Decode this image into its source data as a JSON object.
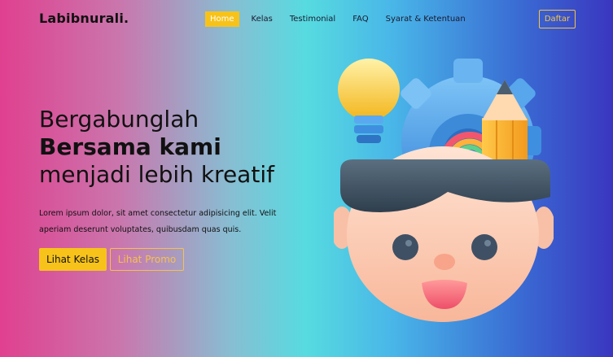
{
  "brand": {
    "logo_text": "Labibnurali."
  },
  "nav": {
    "items": [
      {
        "label": "Home",
        "active": true
      },
      {
        "label": "Kelas",
        "active": false
      },
      {
        "label": "Testimonial",
        "active": false
      },
      {
        "label": "FAQ",
        "active": false
      },
      {
        "label": "Syarat & Ketentuan",
        "active": false
      }
    ],
    "cta_label": "Daftar"
  },
  "hero": {
    "title_line1": "Bergabunglah",
    "title_line2": "Bersama kami",
    "title_line3": "menjadi lebih kreatif",
    "description": "Lorem ipsum dolor, sit amet consectetur adipisicing elit. Velit aperiam deserunt voluptates, quibusdam quas quis.",
    "primary_button": "Lihat Kelas",
    "secondary_button": "Lihat Promo"
  },
  "illustration": {
    "icon": "creative-mind-icon"
  },
  "colors": {
    "accent": "#f7c31a",
    "gradient": [
      "#e0408f",
      "#56dbe0",
      "#3a36c0"
    ]
  }
}
